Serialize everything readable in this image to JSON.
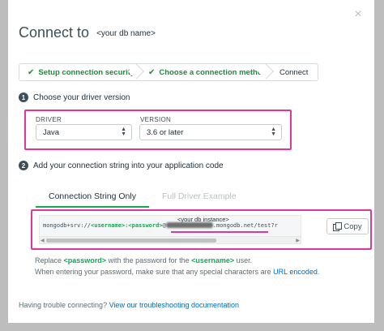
{
  "modal": {
    "title": "Connect to",
    "db_name": "<your db name>",
    "close_glyph": "×"
  },
  "steps": [
    {
      "label": "Setup connection security",
      "done": true
    },
    {
      "label": "Choose a connection method",
      "done": true
    },
    {
      "label": "Connect",
      "done": false
    }
  ],
  "section1": {
    "number": "1",
    "title": "Choose your driver version"
  },
  "driver": {
    "label": "DRIVER",
    "value": "Java",
    "version_label": "VERSION",
    "version_value": "3.6 or later"
  },
  "section2": {
    "number": "2",
    "title": "Add your connection string into your application code"
  },
  "tabs": [
    {
      "label": "Connection String Only",
      "active": true
    },
    {
      "label": "Full Driver Example",
      "active": false
    }
  ],
  "connection": {
    "prefix": "mongodb+srv://",
    "username": "<username>",
    "colon": ":",
    "password": "<password>",
    "at": "@",
    "suffix": ".mongodb.net/test?r",
    "instance_label": "<your db instance>",
    "copy_label": "Copy"
  },
  "help": {
    "line1_pre": "Replace ",
    "password": "<password>",
    "line1_mid": " with the password for the ",
    "username": "<username>",
    "line1_post": " user.",
    "line2_pre": "When entering your password, make sure that any special characters are ",
    "line2_link": "URL encoded",
    "line2_post": "."
  },
  "trouble": {
    "text": "Having trouble connecting?",
    "link": "View our troubleshooting documentation"
  },
  "colors": {
    "accent_green": "#13aa52",
    "highlight_pink": "#e0379a",
    "link_blue": "#006cbc"
  }
}
